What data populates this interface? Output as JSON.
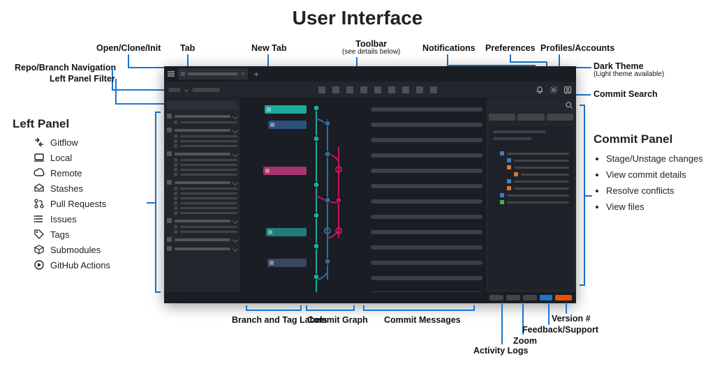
{
  "page_title": "User Interface",
  "annotations": {
    "open_clone": "Open/Clone/Init",
    "tab": "Tab",
    "new_tab": "New Tab",
    "toolbar": "Toolbar",
    "toolbar_sub": "(see details below)",
    "notifications": "Notifications",
    "preferences": "Preferences",
    "profiles": "Profiles/Accounts",
    "dark_theme": "Dark Theme",
    "dark_theme_sub": "(Light theme available)",
    "repo_nav": "Repo/Branch Navigation",
    "filter": "Left Panel Filter",
    "commit_search": "Commit Search",
    "branch_tag": "Branch and Tag Labels",
    "commit_graph": "Commit Graph",
    "commit_messages": "Commit Messages",
    "activity_logs": "Activity Logs",
    "zoom": "Zoom",
    "feedback": "Feedback/Support",
    "version": "Version #"
  },
  "left_panel": {
    "title": "Left Panel",
    "items": [
      {
        "icon": "gitflow",
        "label": "Gitflow"
      },
      {
        "icon": "local",
        "label": "Local"
      },
      {
        "icon": "remote",
        "label": "Remote"
      },
      {
        "icon": "stashes",
        "label": "Stashes"
      },
      {
        "icon": "pr",
        "label": "Pull Requests"
      },
      {
        "icon": "issues",
        "label": "Issues"
      },
      {
        "icon": "tags",
        "label": "Tags"
      },
      {
        "icon": "submodules",
        "label": "Submodules"
      },
      {
        "icon": "actions",
        "label": "GitHub Actions"
      }
    ]
  },
  "commit_panel": {
    "title": "Commit Panel",
    "items": [
      "Stage/Unstage changes",
      "View commit details",
      "Resolve conflicts",
      "View files"
    ]
  },
  "colors": {
    "accent": "#1976d2",
    "teal": "#1aab9b",
    "navy": "#2d4f7c",
    "pink": "#a8336f",
    "orange": "#e65100"
  }
}
